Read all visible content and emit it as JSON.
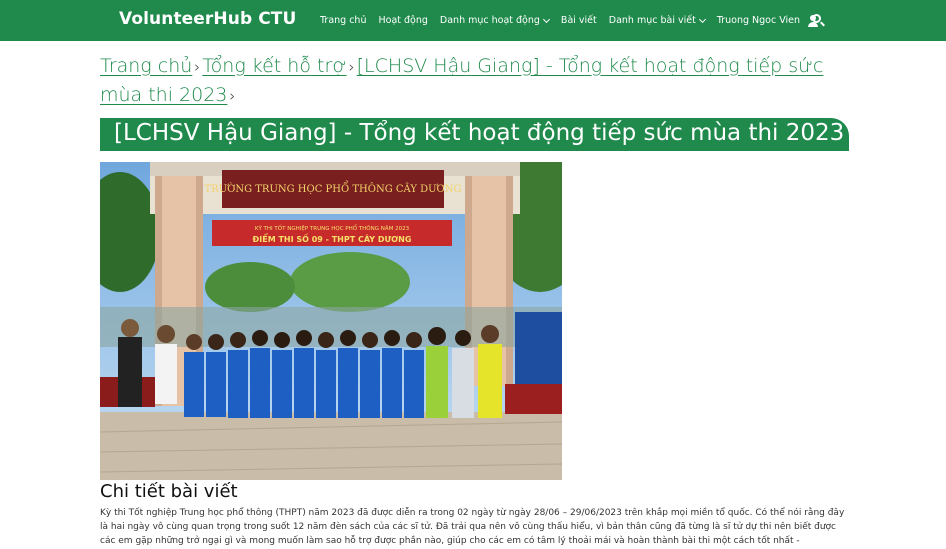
{
  "header": {
    "brand": "VolunteerHub CTU",
    "nav": [
      {
        "label": "Trang chủ"
      },
      {
        "label": "Hoạt động"
      },
      {
        "label": "Danh mục hoạt động"
      },
      {
        "label": "Bài viết"
      },
      {
        "label": "Danh mục bài viết"
      }
    ],
    "user_name": "Truong Ngoc Vien",
    "icons": {
      "user": "user-icon",
      "search": "search-icon",
      "dropdown": "chevron-down-icon"
    }
  },
  "breadcrumb": {
    "items": [
      {
        "label": "Trang chủ"
      },
      {
        "label": "Tổng kết hỗ trợ"
      },
      {
        "label": "[LCHSV Hậu Giang] - Tổng kết hoạt động tiếp sức mùa thi 2023"
      }
    ],
    "separator": "›"
  },
  "article": {
    "title": "[LCHSV Hậu Giang] - Tổng kết hoạt động tiếp sức mùa thi 2023",
    "photo": {
      "school_sign": "TRƯỜNG TRUNG HỌC PHỔ THÔNG CÂY DƯƠNG",
      "banner_line1": "KỲ THI TỐT NGHIỆP TRUNG HỌC PHỔ THÔNG NĂM 2023",
      "banner_line2": "ĐIỂM THI SỐ 09 - THPT CÂY DƯƠNG"
    },
    "section_heading": "Chi tiết bài viết",
    "body": "Kỳ thi Tốt nghiệp Trung học phổ thông (THPT) năm 2023 đã được diễn ra trong 02 ngày từ ngày 28/06 – 29/06/2023 trên khắp mọi miền tổ quốc. Có thể nói rằng đây là hai ngày vô cùng quan trọng trong suốt 12 năm đèn sách của các sĩ tử. Đã trải qua nên vô cùng thấu hiểu, vì bản thân cũng đã từng là sĩ tử dự thi nên biết được các em gặp những trở ngại gì và mong muốn làm sao hỗ trợ được phần nào, giúp cho các em có tâm lý thoải mái và hoàn thành bài thi một cách tốt nhất -"
  },
  "colors": {
    "brand_green": "#1f8a4c",
    "white": "#ffffff",
    "text": "#333333"
  }
}
